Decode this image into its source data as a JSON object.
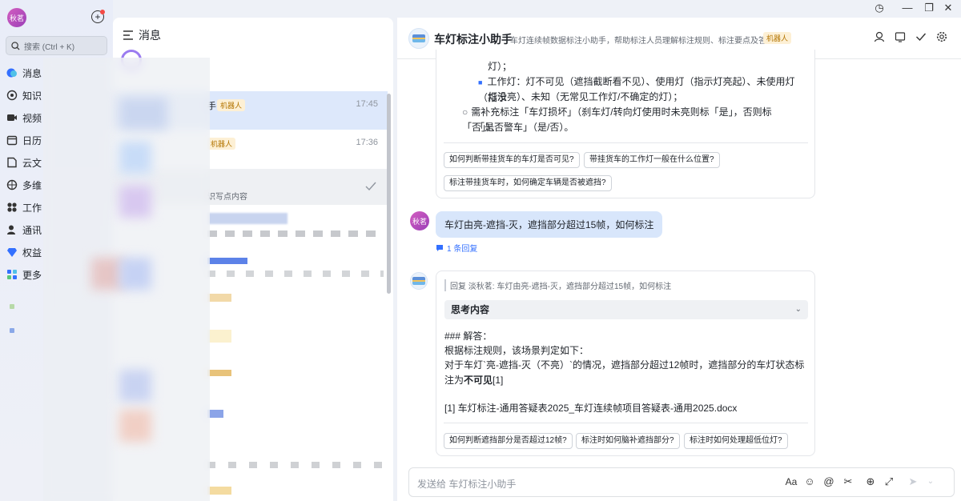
{
  "user": {
    "avatar_text": "秋茗"
  },
  "nav": {
    "search_placeholder": "搜索 (Ctrl + K)",
    "items": [
      {
        "label": "消息",
        "icon": "message-icon",
        "active": true
      },
      {
        "label": "知识",
        "icon": "knowledge-icon"
      },
      {
        "label": "视频",
        "icon": "video-icon"
      },
      {
        "label": "日历",
        "icon": "calendar-icon"
      },
      {
        "label": "云文",
        "icon": "doc-icon"
      },
      {
        "label": "多维",
        "icon": "base-icon"
      },
      {
        "label": "工作",
        "icon": "apps-icon"
      },
      {
        "label": "通讯",
        "icon": "contacts-icon"
      },
      {
        "label": "权益",
        "icon": "diamond-icon"
      },
      {
        "label": "更多",
        "icon": "more-icon"
      }
    ]
  },
  "list": {
    "title": "消息",
    "conversations": [
      {
        "name_suffix": "手",
        "tag": "机器人",
        "time": "17:45",
        "selected": true
      },
      {
        "name_suffix": "",
        "tag": "机器人",
        "time": "17:36",
        "selected": false
      },
      {
        "name_suffix": "",
        "preview": "识写点内容",
        "time": "",
        "selected": false
      }
    ]
  },
  "chat": {
    "title": "车灯标注小助手",
    "description": "车灯连续帧数据标注小助手，帮助标注人员理解标注规则、标注要点及答疑",
    "tag": "机器人",
    "prev_card": {
      "line1": "灯）；",
      "line2": "工作灯：灯不可见（遮挡截断看不见）、使用灯（指示灯亮起）、未使用灯（指示",
      "line3": "灯没亮）、未知（无常见工作灯/不确定的灯）；",
      "line4": "需补充标注「车灯损坏」（刹车灯/转向灯使用时未亮则标「是」，否则标「否」）、",
      "line5": "「是否警车」（是/否）。",
      "suggestions": [
        "如何判断带挂货车的车灯是否可见?",
        "带挂货车的工作灯一般在什么位置?",
        "标注带挂货车时，如何确定车辆是否被遮挡?"
      ]
    },
    "user_message": {
      "avatar_text": "秋茗",
      "text": "车灯由亮-遮挡-灭，遮挡部分超过15帧，如何标注",
      "reply_count": "1 条回复"
    },
    "answer_card": {
      "quote": "回复 淡秋茗: 车灯由亮-遮挡-灭，遮挡部分超过15帧，如何标注",
      "thinking_label": "思考内容",
      "heading": "### 解答：",
      "line1": "根据标注规则，该场景判定如下：",
      "line2_prefix": "对于车灯`亮-遮挡-灭（不亮）`的情况，遮挡部分超过12帧时，遮挡部分的车灯状态标注为",
      "line2_bold": "不可见",
      "line2_ref": "[1]",
      "reference": "[1] 车灯标注-通用答疑表2025_车灯连续帧项目答疑表-通用2025.docx",
      "suggestions": [
        "如何判断遮挡部分是否超过12帧?",
        "标注时如何脑补遮挡部分?",
        "标注时如何处理超低位灯?"
      ]
    },
    "input_placeholder": "发送给 车灯标注小助手"
  },
  "colors": {
    "accent": "#3370ff",
    "user_bubble": "#d8e6fb",
    "bot_tag_bg": "#fdf0d5",
    "bot_tag_fg": "#b37400"
  }
}
